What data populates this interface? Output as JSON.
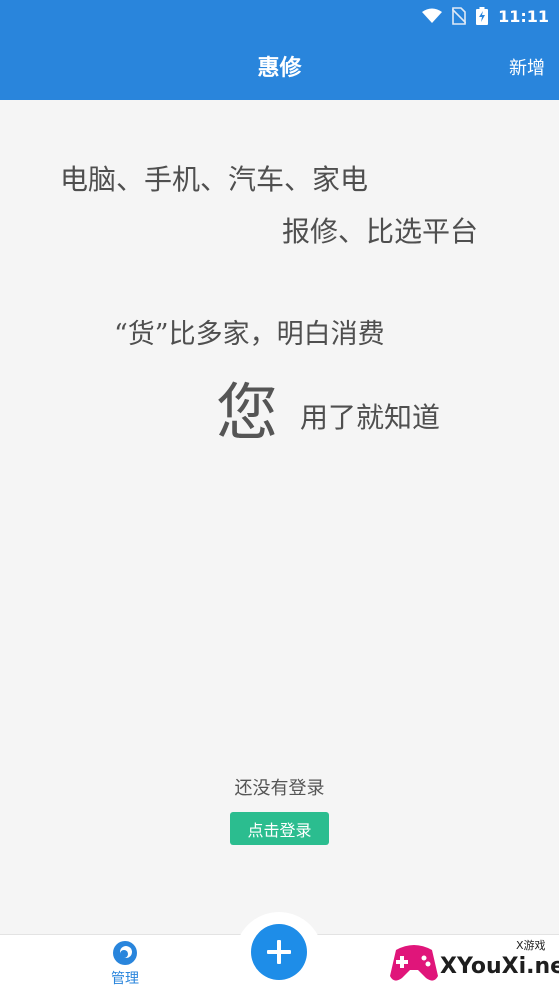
{
  "status_bar": {
    "time": "11:11"
  },
  "header": {
    "title": "惠修",
    "action_label": "新增"
  },
  "slogan": {
    "line1": "电脑、手机、汽车、家电",
    "line2": "报修、比选平台",
    "line3": "“货”比多家，明白消费",
    "big_char": "您",
    "line4": "用了就知道"
  },
  "login": {
    "prompt": "还没有登录",
    "button_label": "点击登录"
  },
  "bottom_nav": {
    "manage_label": "管理"
  },
  "watermark": {
    "text": "XYouXi.net",
    "small": "X游戏"
  },
  "colors": {
    "primary": "#2985dc",
    "login_button": "#2bbd8f",
    "fab": "#1e8de8"
  }
}
